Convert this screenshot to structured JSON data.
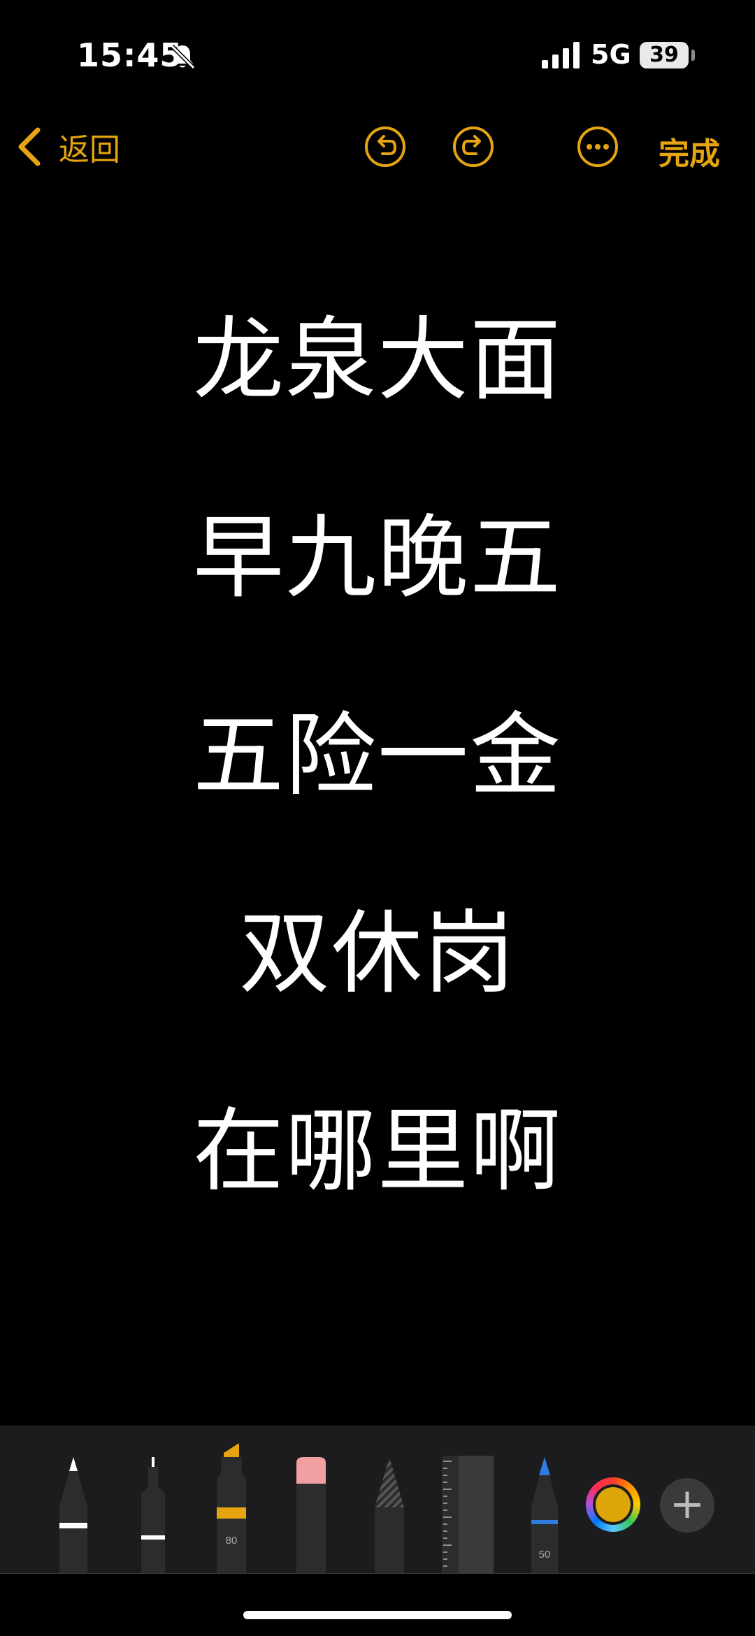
{
  "status_bar": {
    "time": "15:45",
    "network": "5G",
    "battery_level": "39"
  },
  "nav": {
    "back_label": "返回",
    "done_label": "完成"
  },
  "note": {
    "lines": [
      "龙泉大面",
      "早九晚五",
      "五险一金",
      "双休岗",
      "在哪里啊"
    ]
  },
  "tools": {
    "marker_size": "80",
    "pencil_size": "50"
  },
  "colors": {
    "accent": "#e5a410",
    "selected_color": "#dca608"
  }
}
